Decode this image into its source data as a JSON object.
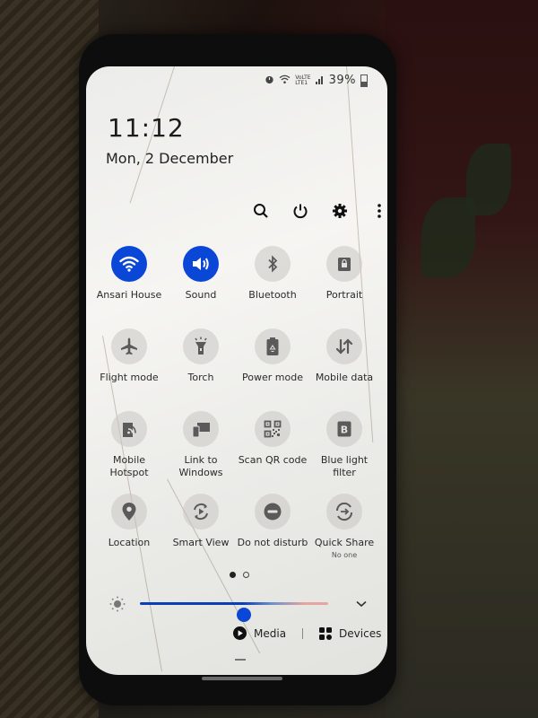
{
  "status_bar": {
    "icons": [
      "alarm-icon",
      "wifi-icon",
      "volte-lte-icon",
      "signal-icon"
    ],
    "volte_label": "VoLTE",
    "lte_label": "LTE1",
    "battery_percent": "39%",
    "battery_level": 0.39
  },
  "header": {
    "time": "11:12",
    "date": "Mon, 2 December"
  },
  "toolbar": {
    "search_label": "Search",
    "power_label": "Power",
    "settings_label": "Settings",
    "more_label": "More options"
  },
  "tiles": [
    {
      "label": "Ansari House",
      "icon": "wifi-icon",
      "on": true
    },
    {
      "label": "Sound",
      "icon": "volume-icon",
      "on": true
    },
    {
      "label": "Bluetooth",
      "icon": "bluetooth-icon",
      "on": false
    },
    {
      "label": "Portrait",
      "icon": "rotation-lock-icon",
      "on": false
    },
    {
      "label": "Flight mode",
      "icon": "airplane-icon",
      "on": false
    },
    {
      "label": "Torch",
      "icon": "torch-icon",
      "on": false
    },
    {
      "label": "Power mode",
      "icon": "battery-saver-icon",
      "on": false
    },
    {
      "label": "Mobile data",
      "icon": "data-arrows-icon",
      "on": false
    },
    {
      "label": "Mobile Hotspot",
      "icon": "hotspot-icon",
      "on": false
    },
    {
      "label": "Link to Windows",
      "icon": "link-windows-icon",
      "on": false
    },
    {
      "label": "Scan QR code",
      "icon": "qr-code-icon",
      "on": false
    },
    {
      "label": "Blue light filter",
      "icon": "blue-light-icon",
      "on": false
    },
    {
      "label": "Location",
      "icon": "location-pin-icon",
      "on": false
    },
    {
      "label": "Smart View",
      "icon": "smart-view-icon",
      "on": false
    },
    {
      "label": "Do not disturb",
      "icon": "dnd-icon",
      "on": false
    },
    {
      "label": "Quick Share",
      "sublabel": "No one",
      "icon": "quick-share-icon",
      "on": false
    }
  ],
  "pager": {
    "total": 2,
    "current": 1
  },
  "brightness": {
    "level": 0.55
  },
  "bottom": {
    "media_label": "Media",
    "devices_label": "Devices"
  },
  "colors": {
    "accent": "#0b47d6",
    "tile_off": "#cfcdca",
    "text": "#222222"
  }
}
